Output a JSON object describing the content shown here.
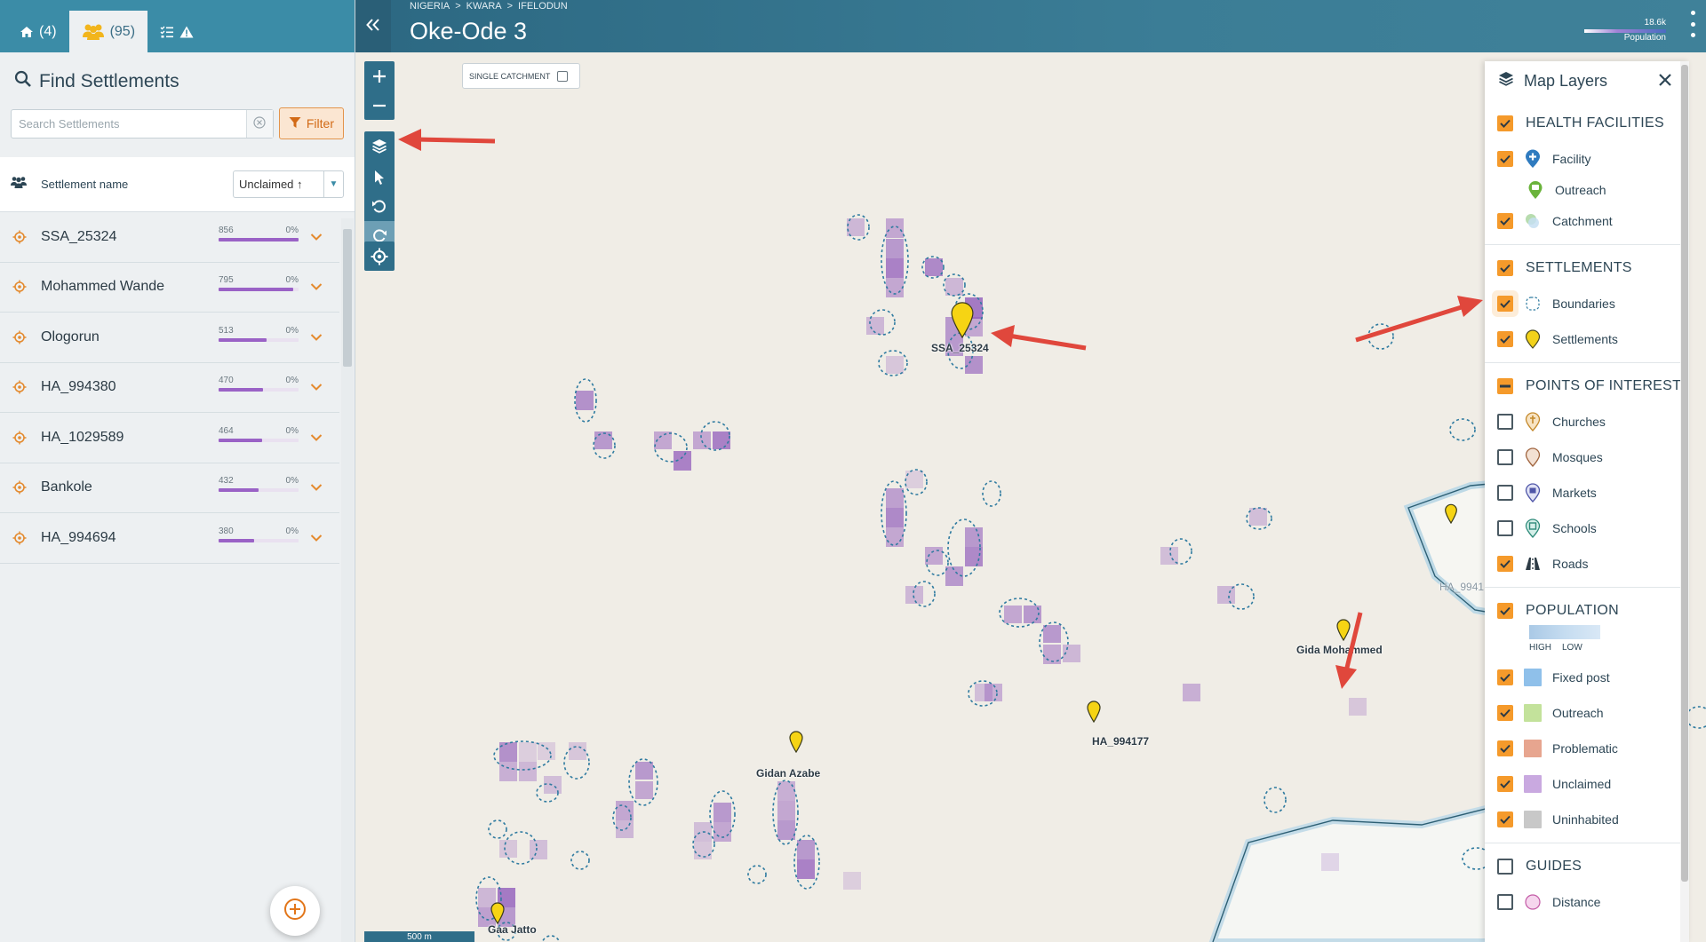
{
  "tabs": {
    "facilities_count": "(4)",
    "settlements_count": "(95)"
  },
  "find": {
    "title": "Find Settlements",
    "search_placeholder": "Search Settlements",
    "filter_label": "Filter"
  },
  "list": {
    "header_label": "Settlement name",
    "sort_value": "Unclaimed ↑",
    "rows": [
      {
        "name": "SSA_25324",
        "pop": "856",
        "pct": "0%"
      },
      {
        "name": "Mohammed Wande",
        "pop": "795",
        "pct": "0%"
      },
      {
        "name": "Ologorun",
        "pop": "513",
        "pct": "0%"
      },
      {
        "name": "HA_994380",
        "pop": "470",
        "pct": "0%"
      },
      {
        "name": "HA_1029589",
        "pop": "464",
        "pct": "0%"
      },
      {
        "name": "Bankole",
        "pop": "432",
        "pct": "0%"
      },
      {
        "name": "HA_994694",
        "pop": "380",
        "pct": "0%"
      }
    ]
  },
  "header": {
    "breadcrumb": [
      "NIGERIA",
      ">",
      "KWARA",
      ">",
      "IFELODUN"
    ],
    "title": "Oke-Ode 3",
    "population_max": "18.6k",
    "population_label": "Population"
  },
  "map": {
    "single_catchment_label": "SINGLE CATCHMENT",
    "scale_label": "500 m",
    "labels": {
      "ssa": "SSA_25324",
      "gida": "Gida Mohammed",
      "ha994177": "HA_994177",
      "gidan": "Gidan Azabe",
      "gaa": "Gaa Jatto",
      "ha941": "HA_9941"
    }
  },
  "layers": {
    "title": "Map Layers",
    "health": {
      "title": "HEALTH FACILITIES",
      "facility": "Facility",
      "outreach": "Outreach",
      "catchment": "Catchment"
    },
    "settlements": {
      "title": "SETTLEMENTS",
      "boundaries": "Boundaries",
      "settlements": "Settlements"
    },
    "poi": {
      "title": "POINTS OF INTEREST",
      "churches": "Churches",
      "mosques": "Mosques",
      "markets": "Markets",
      "schools": "Schools",
      "roads": "Roads"
    },
    "population": {
      "title": "POPULATION",
      "high": "HIGH",
      "low": "LOW",
      "fixed_post": "Fixed post",
      "outreach": "Outreach",
      "problematic": "Problematic",
      "unclaimed": "Unclaimed",
      "uninhabited": "Uninhabited"
    },
    "guides": {
      "title": "GUIDES",
      "distance": "Distance"
    }
  },
  "colors": {
    "accent": "#f59a2b",
    "header": "#3b8ca7",
    "unclaimed": "#c9a9e0",
    "fixed_post": "#8fc0ea",
    "outreach": "#c3e29b",
    "problematic": "#e7a58f",
    "uninhabited": "#c8c8c8"
  }
}
